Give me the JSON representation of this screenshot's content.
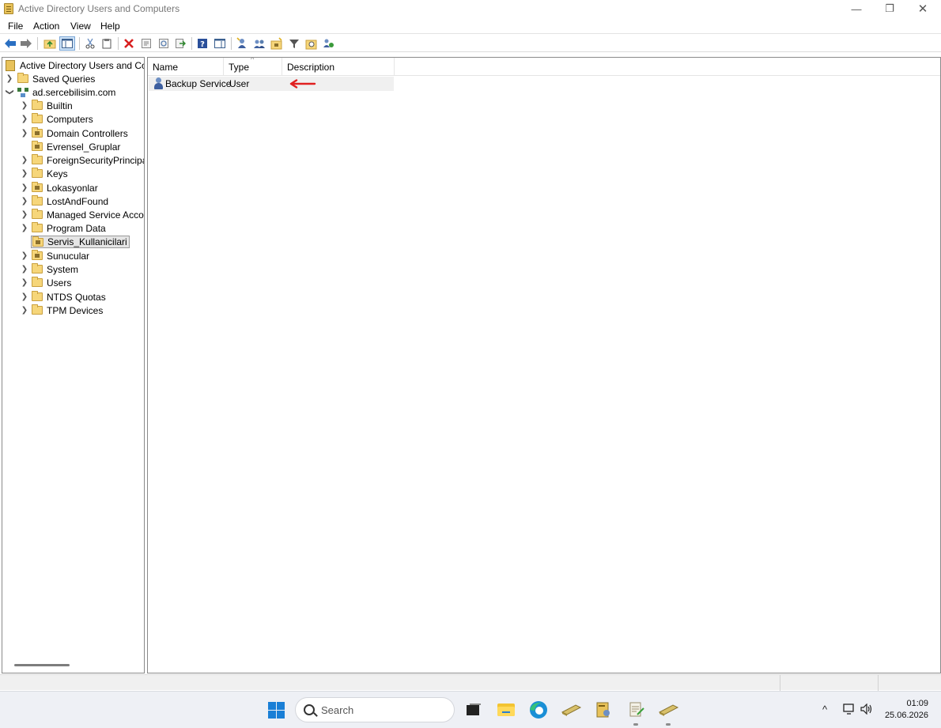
{
  "window": {
    "title": "Active Directory Users and Computers",
    "controls": {
      "minimize": "—",
      "maximize": "❐",
      "close": "✕"
    }
  },
  "menu": [
    "File",
    "Action",
    "View",
    "Help"
  ],
  "toolbar_icons": [
    "back-arrow-icon",
    "forward-arrow-icon",
    "up-folder-icon",
    "show-hide-console-tree-icon",
    "cut-icon",
    "copy-icon",
    "delete-icon",
    "properties-icon",
    "refresh-icon",
    "export-list-icon",
    "help-icon",
    "show-hide-action-pane-icon",
    "new-user-icon",
    "new-group-icon",
    "new-ou-icon",
    "filter-icon",
    "find-icon",
    "add-to-group-icon"
  ],
  "tree": {
    "root": "Active Directory Users and Com",
    "saved_queries": "Saved Queries",
    "domain": "ad.sercebilisim.com",
    "children": [
      {
        "label": "Builtin",
        "ou": false,
        "expandable": true
      },
      {
        "label": "Computers",
        "ou": false,
        "expandable": true
      },
      {
        "label": "Domain Controllers",
        "ou": true,
        "expandable": true
      },
      {
        "label": "Evrensel_Gruplar",
        "ou": true,
        "expandable": false
      },
      {
        "label": "ForeignSecurityPrincipals",
        "ou": false,
        "expandable": true
      },
      {
        "label": "Keys",
        "ou": false,
        "expandable": true
      },
      {
        "label": "Lokasyonlar",
        "ou": true,
        "expandable": true
      },
      {
        "label": "LostAndFound",
        "ou": false,
        "expandable": true
      },
      {
        "label": "Managed Service Accour",
        "ou": false,
        "expandable": true
      },
      {
        "label": "Program Data",
        "ou": false,
        "expandable": true
      },
      {
        "label": "Servis_Kullanicilari",
        "ou": true,
        "expandable": false,
        "selected": true
      },
      {
        "label": "Sunucular",
        "ou": true,
        "expandable": true
      },
      {
        "label": "System",
        "ou": false,
        "expandable": true
      },
      {
        "label": "Users",
        "ou": false,
        "expandable": true
      },
      {
        "label": "NTDS Quotas",
        "ou": false,
        "expandable": true
      },
      {
        "label": "TPM Devices",
        "ou": false,
        "expandable": true
      }
    ]
  },
  "list": {
    "columns": [
      "Name",
      "Type",
      "Description"
    ],
    "rows": [
      {
        "name": "Backup Service",
        "type": "User",
        "description": ""
      }
    ]
  },
  "annotation": {
    "arrow_color": "#e02020"
  },
  "taskbar": {
    "search_placeholder": "Search",
    "clock_time": "01:09",
    "clock_date": "25.06.2026",
    "accent": "#1a7fd6"
  }
}
